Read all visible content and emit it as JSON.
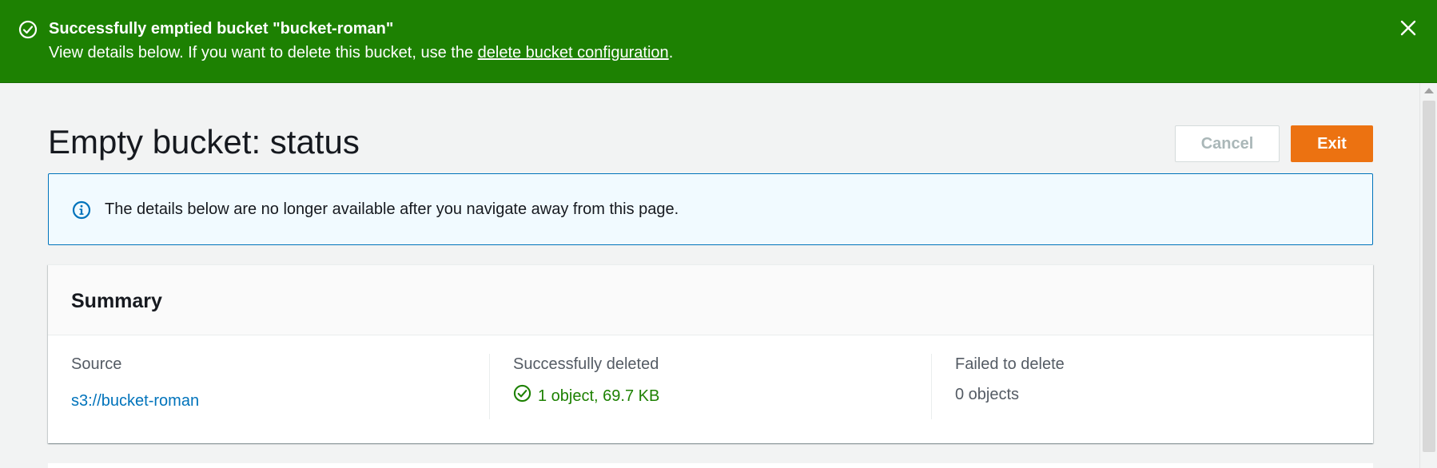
{
  "flash": {
    "title": "Successfully emptied bucket \"bucket-roman\"",
    "message_prefix": "View details below. If you want to delete this bucket, use the ",
    "link_text": "delete bucket configuration",
    "message_suffix": ".",
    "icon": "check-circle-icon",
    "close_icon": "close-icon",
    "color": "#1d8102"
  },
  "page": {
    "title": "Empty bucket: status"
  },
  "actions": {
    "cancel_label": "Cancel",
    "exit_label": "Exit",
    "exit_color": "#ec7211"
  },
  "info_alert": {
    "icon": "info-icon",
    "text": "The details below are no longer available after you navigate away from this page."
  },
  "summary": {
    "title": "Summary",
    "source": {
      "label": "Source",
      "value": "s3://bucket-roman"
    },
    "deleted": {
      "label": "Successfully deleted",
      "value": "1 object, 69.7 KB",
      "icon": "check-circle-icon"
    },
    "failed": {
      "label": "Failed to delete",
      "value": "0 objects"
    }
  }
}
